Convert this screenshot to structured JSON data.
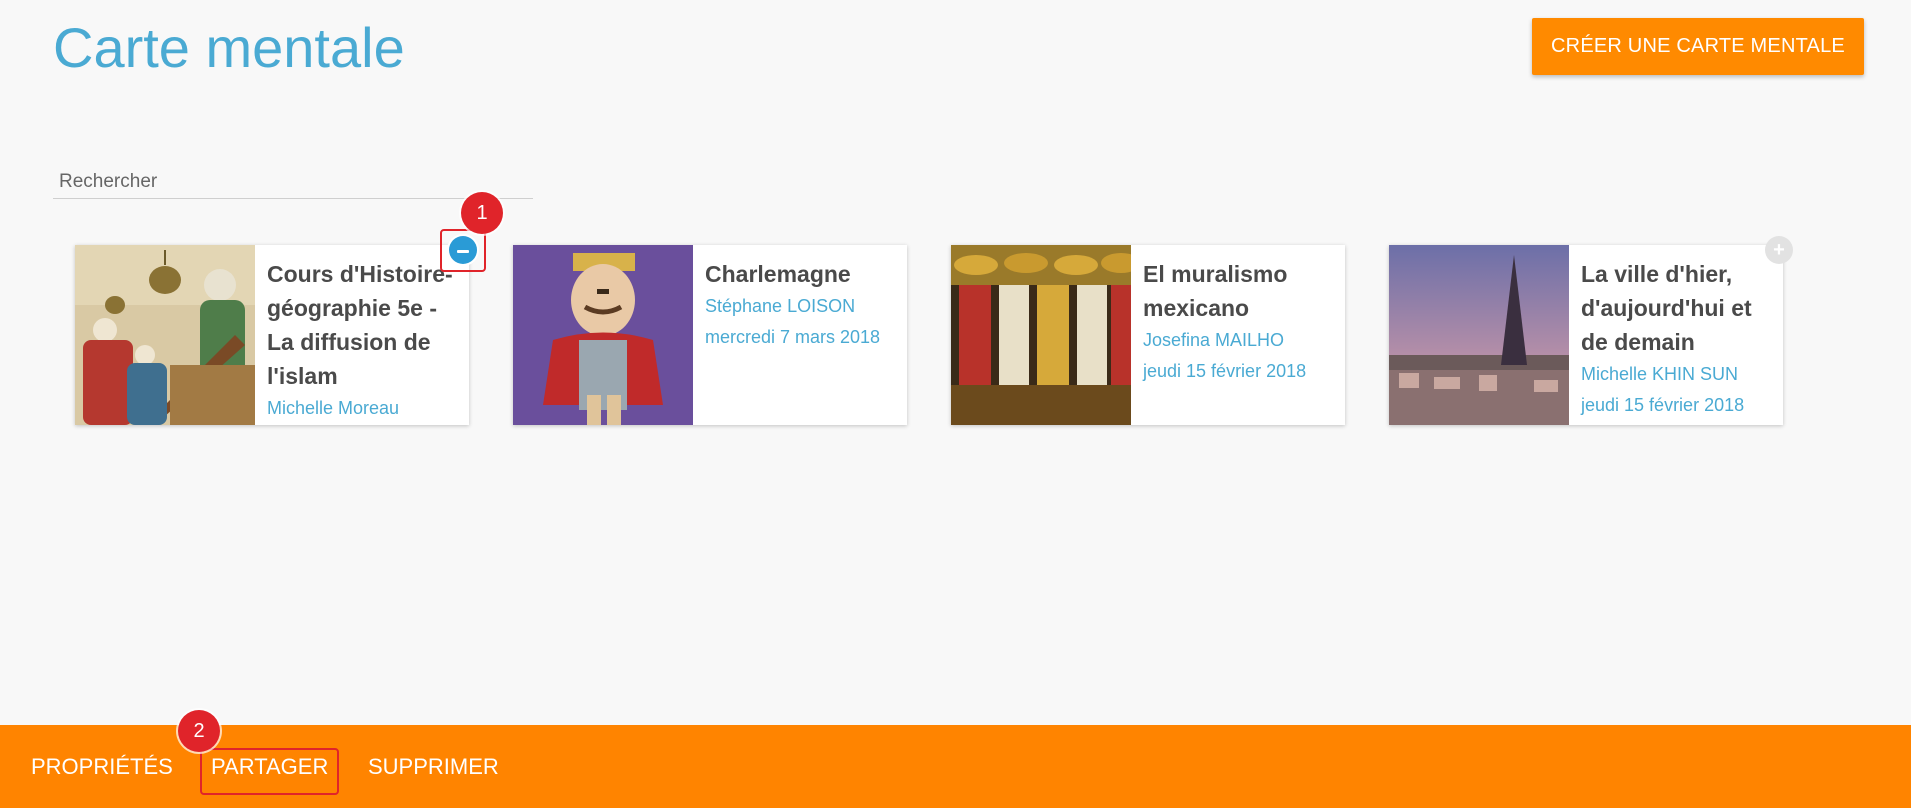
{
  "header": {
    "title": "Carte mentale",
    "create_label": "CRÉER UNE CARTE MENTALE"
  },
  "search": {
    "placeholder": "Rechercher"
  },
  "cards": [
    {
      "title": "Cours d'Histoire-géographie 5e - La diffusion de l'islam",
      "author": "Michelle Moreau",
      "date": "",
      "selected": true
    },
    {
      "title": "Charlemagne",
      "author": "Stéphane LOISON",
      "date": "mercredi 7 mars 2018",
      "selected": false
    },
    {
      "title": "El muralismo mexicano",
      "author": "Josefina MAILHO",
      "date": "jeudi 15 février 2018",
      "selected": false
    },
    {
      "title": "La ville d'hier, d'aujourd'hui et de demain",
      "author": "Michelle KHIN SUN",
      "date": "jeudi 15 février 2018",
      "selected": false
    }
  ],
  "toggles": {
    "selected_symbol": "−",
    "unselected_symbol": "+"
  },
  "annotations": {
    "step1": "1",
    "step2": "2"
  },
  "bottom_bar": {
    "properties_label": "PROPRIÉTÉS",
    "share_label": "PARTAGER",
    "delete_label": "SUPPRIMER"
  },
  "colors": {
    "accent": "#4aaad3",
    "action": "#ff8400",
    "highlight": "#e0242a",
    "selected": "#2a9bd6"
  }
}
